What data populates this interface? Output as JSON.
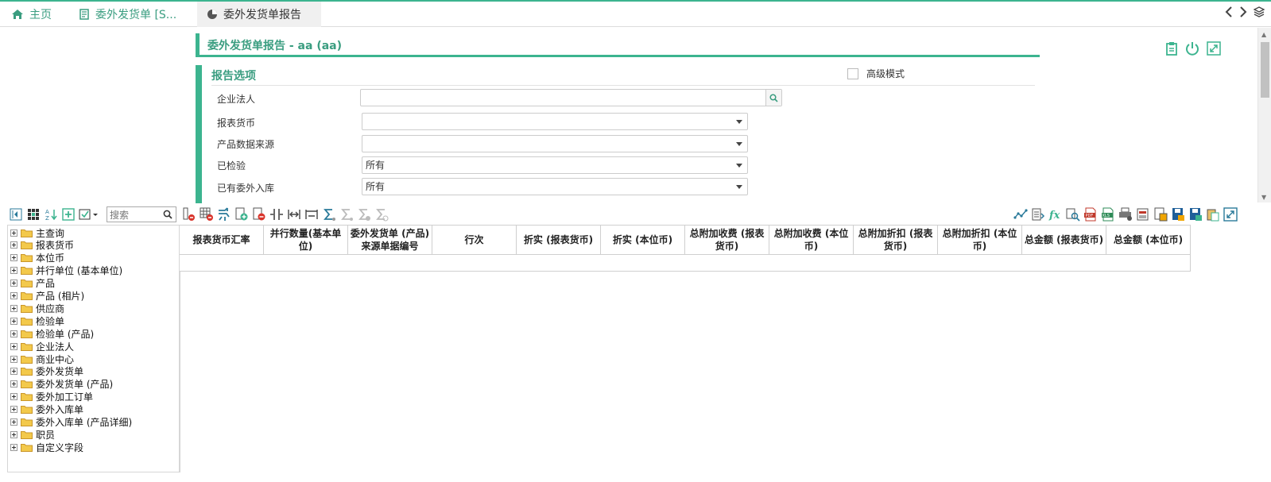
{
  "tabs": [
    {
      "label": "主页",
      "icon": "home-icon"
    },
    {
      "label": "委外发货单 [S...",
      "icon": "edit-document-icon"
    },
    {
      "label": "委外发货单报告",
      "icon": "pie-chart-icon"
    }
  ],
  "page_title": "委外发货单报告 - aa (aa)",
  "options": {
    "title": "报告选项",
    "advanced_mode_label": "高级模式",
    "advanced_mode_checked": false,
    "fields": [
      {
        "label": "企业法人",
        "value": "",
        "type": "search"
      },
      {
        "label": "报表货币",
        "value": "",
        "type": "select"
      },
      {
        "label": "产品数据来源",
        "value": "",
        "type": "select"
      },
      {
        "label": "已检验",
        "value": "所有",
        "type": "select"
      },
      {
        "label": "已有委外入库",
        "value": "所有",
        "type": "select"
      }
    ]
  },
  "toolbar": {
    "search_placeholder": "搜索"
  },
  "tree": {
    "items": [
      "主查询",
      "报表货币",
      "本位币",
      "并行单位 (基本单位)",
      "产品",
      "产品 (相片)",
      "供应商",
      "检验单",
      "检验单 (产品)",
      "企业法人",
      "商业中心",
      "委外发货单",
      "委外发货单 (产品)",
      "委外加工订单",
      "委外入库单",
      "委外入库单 (产品详细)",
      "职员",
      "自定义字段"
    ]
  },
  "grid": {
    "columns": [
      "报表货币汇率",
      "并行数量(基本单位)",
      "委外发货单 (产品) 来源单据编号",
      "行次",
      "折实 (报表货币)",
      "折实 (本位币)",
      "总附加收费 (报表货币)",
      "总附加收费 (本位币)",
      "总附加折扣 (报表货币)",
      "总附加折扣 (本位币)",
      "总金额 (报表货币)",
      "总金额 (本位币)"
    ],
    "rows": []
  },
  "colors": {
    "accent": "#3cb48f",
    "accent_text": "#3a9d80"
  }
}
